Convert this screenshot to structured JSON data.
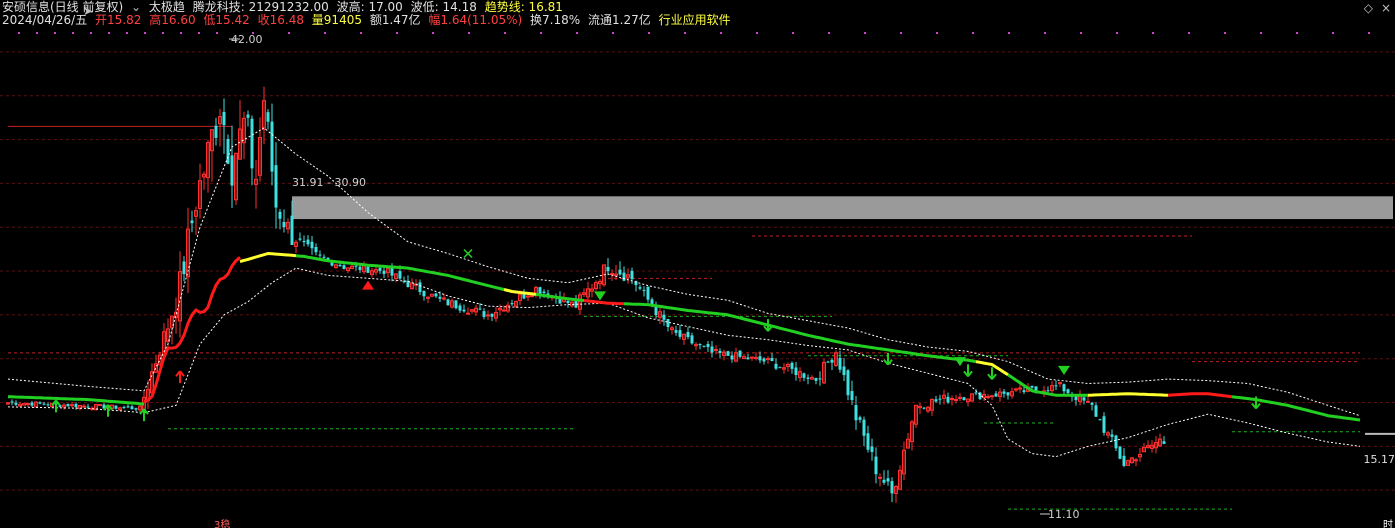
{
  "header": {
    "stock_name": "安硕信息(日线 前复权)",
    "indicator_name": "太极趋",
    "indicator_label": "腾龙科技: 21291232.00",
    "wave_high": "波高: 17.00",
    "wave_low": "波低: 14.18",
    "trend_line": "趋势线: 16.81"
  },
  "quote": {
    "date": "2024/04/26/五",
    "open": "开15.82",
    "high": "高16.60",
    "low": "低15.42",
    "close": "收16.48",
    "volume": "量91405",
    "amount": "额1.47亿",
    "change": "幅1.64(11.05%)",
    "turnover": "换7.18%",
    "float_cap": "流通1.27亿",
    "industry": "行业应用软件"
  },
  "annotations": {
    "high_label": "42.00",
    "gap_label": "31.91 - 30.90",
    "low_label": "11.10",
    "last_price": "15.17",
    "bottom_tag": "3稳",
    "right_tag": "时"
  },
  "colors": {
    "up": "#ff3030",
    "down": "#40e0e0",
    "trend_green": "#22d022",
    "trend_red": "#ff1a1a",
    "trend_yellow": "#ffff30",
    "band": "#ffffff",
    "gap_box": "#9a9a9a",
    "grid": "#5a1010"
  },
  "chart_data": {
    "type": "candlestick",
    "title": "安硕信息(日线 前复权)",
    "ylim": [
      10.3,
      43.5
    ],
    "grid": true,
    "gap_zone": [
      30.9,
      31.91
    ],
    "last_close": 15.17,
    "period_high": 42.0,
    "period_low": 11.1,
    "trend_line": [
      {
        "i": 0,
        "v": 18.4
      },
      {
        "i": 20,
        "v": 18.2
      },
      {
        "i": 34,
        "v": 17.9
      },
      {
        "i": 36,
        "v": 18.7
      },
      {
        "i": 40,
        "v": 21.5
      },
      {
        "i": 44,
        "v": 22.6
      },
      {
        "i": 47,
        "v": 24.3
      },
      {
        "i": 50,
        "v": 24.6
      },
      {
        "i": 53,
        "v": 26.3
      },
      {
        "i": 56,
        "v": 27.5
      },
      {
        "i": 60,
        "v": 27.8
      },
      {
        "i": 65,
        "v": 28.2
      },
      {
        "i": 70,
        "v": 28.1
      },
      {
        "i": 74,
        "v": 28.0
      },
      {
        "i": 80,
        "v": 27.7
      },
      {
        "i": 90,
        "v": 27.4
      },
      {
        "i": 100,
        "v": 27.2
      },
      {
        "i": 110,
        "v": 26.7
      },
      {
        "i": 120,
        "v": 26.0
      },
      {
        "i": 126,
        "v": 25.6
      },
      {
        "i": 132,
        "v": 25.4
      },
      {
        "i": 140,
        "v": 25.1
      },
      {
        "i": 150,
        "v": 24.8
      },
      {
        "i": 160,
        "v": 24.7
      },
      {
        "i": 170,
        "v": 24.3
      },
      {
        "i": 180,
        "v": 24.0
      },
      {
        "i": 190,
        "v": 23.3
      },
      {
        "i": 200,
        "v": 22.6
      },
      {
        "i": 210,
        "v": 22.0
      },
      {
        "i": 220,
        "v": 21.6
      },
      {
        "i": 230,
        "v": 21.2
      },
      {
        "i": 236,
        "v": 21.0
      },
      {
        "i": 240,
        "v": 20.9
      },
      {
        "i": 246,
        "v": 20.6
      },
      {
        "i": 250,
        "v": 19.9
      },
      {
        "i": 256,
        "v": 18.8
      },
      {
        "i": 262,
        "v": 18.5
      },
      {
        "i": 270,
        "v": 18.5
      },
      {
        "i": 280,
        "v": 18.6
      },
      {
        "i": 290,
        "v": 18.5
      },
      {
        "i": 296,
        "v": 18.6
      },
      {
        "i": 300,
        "v": 18.6
      },
      {
        "i": 306,
        "v": 18.4
      },
      {
        "i": 312,
        "v": 18.2
      },
      {
        "i": 320,
        "v": 17.8
      },
      {
        "i": 330,
        "v": 17.1
      },
      {
        "i": 338,
        "v": 16.8
      }
    ],
    "trend_segments": [
      {
        "from": 0,
        "to": 34,
        "state": "green"
      },
      {
        "from": 34,
        "to": 58,
        "state": "red"
      },
      {
        "from": 58,
        "to": 72,
        "state": "yellow"
      },
      {
        "from": 72,
        "to": 106,
        "state": "green"
      },
      {
        "from": 106,
        "to": 124,
        "state": "green"
      },
      {
        "from": 124,
        "to": 132,
        "state": "yellow"
      },
      {
        "from": 132,
        "to": 144,
        "state": "green"
      },
      {
        "from": 144,
        "to": 154,
        "state": "red"
      },
      {
        "from": 154,
        "to": 242,
        "state": "green"
      },
      {
        "from": 242,
        "to": 250,
        "state": "yellow"
      },
      {
        "from": 250,
        "to": 270,
        "state": "green"
      },
      {
        "from": 270,
        "to": 290,
        "state": "yellow"
      },
      {
        "from": 290,
        "to": 306,
        "state": "red"
      },
      {
        "from": 306,
        "to": 338,
        "state": "green"
      }
    ],
    "upper_band": [
      {
        "i": 0,
        "v": 19.6
      },
      {
        "i": 20,
        "v": 19.1
      },
      {
        "i": 34,
        "v": 18.8
      },
      {
        "i": 40,
        "v": 22.0
      },
      {
        "i": 48,
        "v": 30.0
      },
      {
        "i": 56,
        "v": 35.5
      },
      {
        "i": 64,
        "v": 36.8
      },
      {
        "i": 72,
        "v": 35.0
      },
      {
        "i": 80,
        "v": 33.5
      },
      {
        "i": 90,
        "v": 31.0
      },
      {
        "i": 100,
        "v": 29.0
      },
      {
        "i": 110,
        "v": 28.2
      },
      {
        "i": 120,
        "v": 27.3
      },
      {
        "i": 130,
        "v": 26.5
      },
      {
        "i": 140,
        "v": 26.2
      },
      {
        "i": 150,
        "v": 26.8
      },
      {
        "i": 160,
        "v": 26.0
      },
      {
        "i": 170,
        "v": 25.4
      },
      {
        "i": 180,
        "v": 25.0
      },
      {
        "i": 190,
        "v": 24.1
      },
      {
        "i": 200,
        "v": 23.6
      },
      {
        "i": 210,
        "v": 23.1
      },
      {
        "i": 220,
        "v": 22.3
      },
      {
        "i": 230,
        "v": 21.8
      },
      {
        "i": 240,
        "v": 21.5
      },
      {
        "i": 250,
        "v": 20.8
      },
      {
        "i": 260,
        "v": 19.6
      },
      {
        "i": 270,
        "v": 19.3
      },
      {
        "i": 280,
        "v": 19.4
      },
      {
        "i": 290,
        "v": 19.6
      },
      {
        "i": 300,
        "v": 19.5
      },
      {
        "i": 310,
        "v": 19.3
      },
      {
        "i": 320,
        "v": 18.7
      },
      {
        "i": 330,
        "v": 17.8
      },
      {
        "i": 338,
        "v": 17.1
      }
    ],
    "lower_band": [
      {
        "i": 0,
        "v": 17.7
      },
      {
        "i": 20,
        "v": 17.6
      },
      {
        "i": 34,
        "v": 17.3
      },
      {
        "i": 42,
        "v": 17.8
      },
      {
        "i": 48,
        "v": 22.0
      },
      {
        "i": 54,
        "v": 24.0
      },
      {
        "i": 60,
        "v": 24.9
      },
      {
        "i": 66,
        "v": 26.2
      },
      {
        "i": 72,
        "v": 27.2
      },
      {
        "i": 80,
        "v": 26.7
      },
      {
        "i": 90,
        "v": 26.5
      },
      {
        "i": 100,
        "v": 26.3
      },
      {
        "i": 110,
        "v": 25.3
      },
      {
        "i": 120,
        "v": 24.6
      },
      {
        "i": 130,
        "v": 24.5
      },
      {
        "i": 140,
        "v": 24.7
      },
      {
        "i": 150,
        "v": 24.8
      },
      {
        "i": 160,
        "v": 23.8
      },
      {
        "i": 170,
        "v": 23.2
      },
      {
        "i": 180,
        "v": 22.6
      },
      {
        "i": 190,
        "v": 22.3
      },
      {
        "i": 200,
        "v": 21.9
      },
      {
        "i": 210,
        "v": 21.6
      },
      {
        "i": 220,
        "v": 20.7
      },
      {
        "i": 230,
        "v": 20.0
      },
      {
        "i": 240,
        "v": 19.3
      },
      {
        "i": 246,
        "v": 17.8
      },
      {
        "i": 250,
        "v": 15.5
      },
      {
        "i": 256,
        "v": 14.5
      },
      {
        "i": 262,
        "v": 14.3
      },
      {
        "i": 270,
        "v": 15.0
      },
      {
        "i": 280,
        "v": 15.6
      },
      {
        "i": 290,
        "v": 16.5
      },
      {
        "i": 300,
        "v": 17.2
      },
      {
        "i": 310,
        "v": 16.6
      },
      {
        "i": 320,
        "v": 15.9
      },
      {
        "i": 330,
        "v": 15.3
      },
      {
        "i": 338,
        "v": 15.0
      }
    ],
    "segments": [
      {
        "n": 34,
        "from": 18.0,
        "to": 17.6,
        "vol": 0.22
      },
      {
        "n": 6,
        "from": 17.6,
        "to": 22.5,
        "vol": 0.9
      },
      {
        "n": 4,
        "from": 22.5,
        "to": 26.0,
        "vol": 1.6
      },
      {
        "n": 4,
        "from": 26.0,
        "to": 31.8,
        "vol": 1.8
      },
      {
        "n": 3,
        "from": 31.8,
        "to": 35.0,
        "vol": 2.2
      },
      {
        "n": 3,
        "from": 35.0,
        "to": 38.5,
        "vol": 2.4
      },
      {
        "n": 3,
        "from": 38.5,
        "to": 34.5,
        "vol": 2.6
      },
      {
        "n": 3,
        "from": 34.5,
        "to": 37.0,
        "vol": 2.2
      },
      {
        "n": 3,
        "from": 37.0,
        "to": 33.5,
        "vol": 2.6
      },
      {
        "n": 2,
        "from": 33.5,
        "to": 38.8,
        "vol": 1.6
      },
      {
        "n": 3,
        "from": 38.8,
        "to": 31.5,
        "vol": 1.8
      },
      {
        "n": 4,
        "from": 31.5,
        "to": 29.4,
        "vol": 1.2
      },
      {
        "n": 5,
        "from": 29.4,
        "to": 28.2,
        "vol": 0.6
      },
      {
        "n": 8,
        "from": 28.2,
        "to": 27.3,
        "vol": 0.4
      },
      {
        "n": 10,
        "from": 27.3,
        "to": 27.0,
        "vol": 0.35
      },
      {
        "n": 14,
        "from": 27.0,
        "to": 25.0,
        "vol": 0.45
      },
      {
        "n": 12,
        "from": 25.0,
        "to": 24.0,
        "vol": 0.45
      },
      {
        "n": 12,
        "from": 24.0,
        "to": 25.8,
        "vol": 0.45
      },
      {
        "n": 10,
        "from": 25.8,
        "to": 24.6,
        "vol": 0.45
      },
      {
        "n": 8,
        "from": 24.6,
        "to": 27.4,
        "vol": 0.7
      },
      {
        "n": 6,
        "from": 27.4,
        "to": 26.5,
        "vol": 0.7
      },
      {
        "n": 10,
        "from": 26.5,
        "to": 22.8,
        "vol": 0.55
      },
      {
        "n": 10,
        "from": 22.8,
        "to": 21.4,
        "vol": 0.45
      },
      {
        "n": 14,
        "from": 21.4,
        "to": 20.8,
        "vol": 0.4
      },
      {
        "n": 12,
        "from": 20.8,
        "to": 19.6,
        "vol": 0.45
      },
      {
        "n": 5,
        "from": 19.6,
        "to": 21.5,
        "vol": 0.6
      },
      {
        "n": 5,
        "from": 21.5,
        "to": 17.0,
        "vol": 0.8
      },
      {
        "n": 5,
        "from": 17.0,
        "to": 13.5,
        "vol": 0.9
      },
      {
        "n": 4,
        "from": 13.5,
        "to": 11.7,
        "vol": 0.8
      },
      {
        "n": 6,
        "from": 11.7,
        "to": 17.8,
        "vol": 0.8
      },
      {
        "n": 10,
        "from": 17.8,
        "to": 18.4,
        "vol": 0.5
      },
      {
        "n": 12,
        "from": 18.4,
        "to": 18.6,
        "vol": 0.4
      },
      {
        "n": 14,
        "from": 18.6,
        "to": 19.1,
        "vol": 0.4
      },
      {
        "n": 8,
        "from": 19.1,
        "to": 17.7,
        "vol": 0.5
      },
      {
        "n": 8,
        "from": 17.7,
        "to": 13.8,
        "vol": 0.6
      },
      {
        "n": 10,
        "from": 13.8,
        "to": 15.6,
        "vol": 0.5
      }
    ],
    "signals": {
      "up_arrows": [
        {
          "i": 12,
          "v": 17.6,
          "color": "green"
        },
        {
          "i": 25,
          "v": 17.3,
          "color": "green"
        },
        {
          "i": 34,
          "v": 17.0,
          "color": "green"
        },
        {
          "i": 43,
          "v": 19.6,
          "color": "red"
        }
      ],
      "down_arrows": [
        {
          "i": 190,
          "v": 23.3
        },
        {
          "i": 220,
          "v": 21.0
        },
        {
          "i": 240,
          "v": 20.2
        },
        {
          "i": 246,
          "v": 20.0
        },
        {
          "i": 312,
          "v": 18.0
        }
      ],
      "triangles_down_green": [
        {
          "i": 148,
          "v": 25.2
        },
        {
          "i": 238,
          "v": 20.7
        },
        {
          "i": 264,
          "v": 20.1
        }
      ],
      "triangles_up_red": [
        {
          "i": 90,
          "v": 26.0
        }
      ],
      "x_marks": [
        {
          "i": 115,
          "v": 28.2
        }
      ]
    },
    "horizontal_levels": [
      {
        "from_i": 0,
        "to_i": 56,
        "v": 36.9,
        "color": "red",
        "style": "solid"
      },
      {
        "from_i": 0,
        "to_i": 338,
        "v": 21.4,
        "color": "red",
        "style": "dash"
      },
      {
        "from_i": 40,
        "to_i": 142,
        "v": 16.2,
        "color": "green",
        "style": "dash"
      },
      {
        "from_i": 144,
        "to_i": 206,
        "v": 23.9,
        "color": "green",
        "style": "dash"
      },
      {
        "from_i": 186,
        "to_i": 296,
        "v": 29.4,
        "color": "red",
        "style": "dash"
      },
      {
        "from_i": 150,
        "to_i": 176,
        "v": 26.5,
        "color": "red",
        "style": "dash"
      },
      {
        "from_i": 244,
        "to_i": 262,
        "v": 16.6,
        "color": "green",
        "style": "dash"
      },
      {
        "from_i": 250,
        "to_i": 306,
        "v": 10.7,
        "color": "green",
        "style": "dash"
      },
      {
        "from_i": 296,
        "to_i": 338,
        "v": 20.8,
        "color": "red",
        "style": "dash"
      },
      {
        "from_i": 306,
        "to_i": 338,
        "v": 16.0,
        "color": "green",
        "style": "dash"
      },
      {
        "from_i": 200,
        "to_i": 250,
        "v": 21.2,
        "color": "green",
        "style": "dash"
      }
    ]
  }
}
